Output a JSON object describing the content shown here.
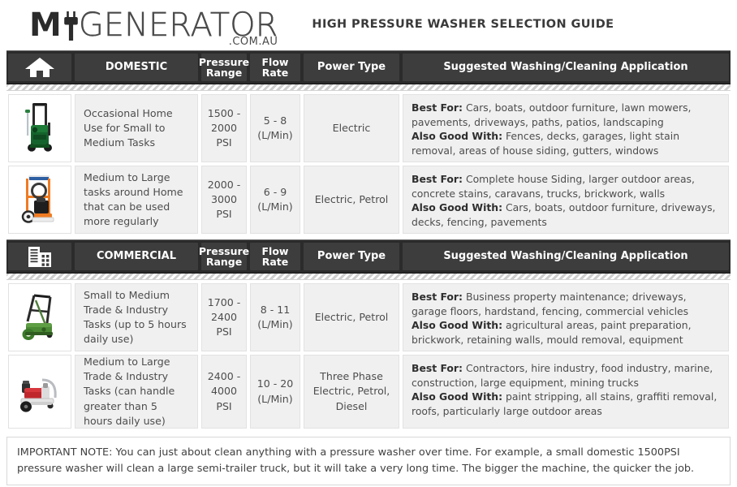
{
  "brand": {
    "logo_my": "M",
    "logo_plug_icon": "power-plug-icon",
    "logo_rest": "GENERATOR",
    "logo_tld": ".COM.AU"
  },
  "header": {
    "guide_title": "HIGH PRESSURE WASHER SELECTION GUIDE"
  },
  "columns": {
    "pressure_range": "Pressure\nRange",
    "pressure_range_l1": "Pressure",
    "pressure_range_l2": "Range",
    "flow_rate_l1": "Flow",
    "flow_rate_l2": "Rate",
    "power_type": "Power Type",
    "application": "Suggested Washing/Cleaning Application"
  },
  "sections": [
    {
      "id": "domestic",
      "icon": "house-icon",
      "label": "DOMESTIC",
      "rows": [
        {
          "product_icon": "green-electric-pressure-washer",
          "description": "Occasional Home Use for Small to Medium Tasks",
          "pressure_range": "1500 - 2000 PSI",
          "flow_rate_value": "5 - 8",
          "flow_rate_unit": "(L/Min)",
          "power_type": "Electric",
          "best_for_label": "Best For:",
          "best_for": "Cars, boats, outdoor furniture, lawn mowers, pavements, driveways, paths, patios, landscaping",
          "also_good_label": "Also Good With:",
          "also_good": "Fences, decks, garages, light stain removal, areas of house siding, gutters, windows"
        },
        {
          "product_icon": "orange-petrol-pressure-washer",
          "description": "Medium to Large tasks around Home that can be used more regularly",
          "pressure_range": "2000 - 3000 PSI",
          "flow_rate_value": "6 - 9",
          "flow_rate_unit": "(L/Min)",
          "power_type": "Electric, Petrol",
          "best_for_label": "Best For:",
          "best_for": "Complete house Siding, larger outdoor areas, concrete stains, caravans, trucks, brickwork, walls",
          "also_good_label": "Also Good With:",
          "also_good": "Cars, boats, outdoor furniture, driveways, decks, fencing, pavements"
        }
      ]
    },
    {
      "id": "commercial",
      "icon": "office-building-icon",
      "label": "COMMERCIAL",
      "rows": [
        {
          "product_icon": "green-trade-pressure-washer",
          "description": "Small to Medium Trade & Industry Tasks (up to 5 hours daily use)",
          "pressure_range": "1700 - 2400 PSI",
          "flow_rate_value": "8 - 11",
          "flow_rate_unit": "(L/Min)",
          "power_type": "Electric, Petrol",
          "best_for_label": "Best For:",
          "best_for": " Business property maintenance; driveways, garage floors, hardstand, fencing, commercial vehicles",
          "also_good_label": "Also Good With:",
          "also_good": "agricultural areas, paint preparation, brickwork, retaining walls, mould removal, equipment"
        },
        {
          "product_icon": "red-industrial-pressure-washer",
          "description": "Medium to Large Trade & Industry Tasks (can handle greater than 5 hours daily use)",
          "pressure_range": "2400 - 4000 PSI",
          "flow_rate_value": "10 - 20",
          "flow_rate_unit": "(L/Min)",
          "power_type": "Three Phase Electric, Petrol, Diesel",
          "best_for_label": "Best For:",
          "best_for": "Contractors, hire industry, food industry, marine, construction, large equipment, mining trucks",
          "also_good_label": "Also Good With:",
          "also_good": "paint stripping, all stains, graffiti removal, roofs, particularly large outdoor areas"
        }
      ]
    }
  ],
  "footer": {
    "note_label": "IMPORTANT NOTE:",
    "note_text": " You can just about clean anything with a pressure washer over time. For example, a small domestic 1500PSI pressure washer will clean a large semi-trailer truck, but it will take a very long time. The bigger the machine, the quicker the job."
  },
  "colors": {
    "header_bg": "#3d3d3d",
    "header_rail": "#2b2b2b",
    "cell_bg": "#f0f0f0",
    "text": "#4d4d4d",
    "bold_text": "#2e2e2e"
  }
}
